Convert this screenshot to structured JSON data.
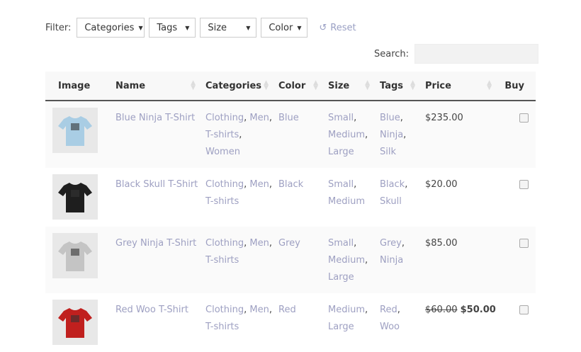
{
  "filter": {
    "label": "Filter:",
    "selects": [
      "Categories",
      "Tags",
      "Size",
      "Color"
    ],
    "reset": "Reset"
  },
  "search": {
    "label": "Search:",
    "value": ""
  },
  "columns": [
    "Image",
    "Name",
    "Categories",
    "Color",
    "Size",
    "Tags",
    "Price",
    "Buy"
  ],
  "products": [
    {
      "name": "Blue Ninja T-Shirt",
      "shirt_color": "#a9cde4",
      "categories": [
        "Clothing",
        "Men",
        "T-shirts",
        "Women"
      ],
      "color": "Blue",
      "sizes": [
        "Small",
        "Medium",
        "Large"
      ],
      "tags": [
        "Blue",
        "Ninja",
        "Silk"
      ],
      "price": "$235.00",
      "old_price": ""
    },
    {
      "name": "Black Skull T-Shirt",
      "shirt_color": "#1e1e1e",
      "categories": [
        "Clothing",
        "Men",
        "T-shirts"
      ],
      "color": "Black",
      "sizes": [
        "Small",
        "Medium"
      ],
      "tags": [
        "Black",
        "Skull"
      ],
      "price": "$20.00",
      "old_price": ""
    },
    {
      "name": "Grey Ninja T-Shirt",
      "shirt_color": "#c4c4c4",
      "categories": [
        "Clothing",
        "Men",
        "T-shirts"
      ],
      "color": "Grey",
      "sizes": [
        "Small",
        "Medium",
        "Large"
      ],
      "tags": [
        "Grey",
        "Ninja"
      ],
      "price": "$85.00",
      "old_price": ""
    },
    {
      "name": "Red Woo T-Shirt",
      "shirt_color": "#c0201e",
      "categories": [
        "Clothing",
        "Men",
        "T-shirts"
      ],
      "color": "Red",
      "sizes": [
        "Medium",
        "Large"
      ],
      "tags": [
        "Red",
        "Woo"
      ],
      "price": "$50.00",
      "old_price": "$60.00"
    }
  ]
}
